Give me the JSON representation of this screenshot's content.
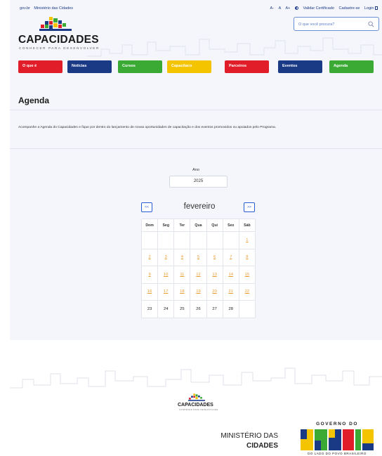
{
  "topbar": {
    "gov_link": "gov.br",
    "ministry_link": "Ministério das Cidades",
    "font_decrease": "A-",
    "font_normal": "A",
    "font_increase": "A+",
    "validate": "Validar Certificado",
    "register": "Cadastre-se",
    "login": "Login"
  },
  "logo": {
    "name": "CAPACIDADES",
    "tagline": "CONHECER PARA DESENVOLVER"
  },
  "search": {
    "placeholder": "O que você procura?"
  },
  "nav": {
    "items": [
      {
        "label": "O que é",
        "color": "#e11d2a"
      },
      {
        "label": "Notícias",
        "color": "#1b3a86"
      },
      {
        "label": "Cursos",
        "color": "#3aaa35"
      },
      {
        "label": "Capacitaco",
        "color": "#f5c400"
      },
      {
        "label": "Parceiros",
        "color": "#e11d2a"
      },
      {
        "label": "Eventos",
        "color": "#1b3a86"
      },
      {
        "label": "Agenda",
        "color": "#3aaa35"
      }
    ]
  },
  "page": {
    "title": "Agenda",
    "description": "Acompanhe a Agenda do Capacidades e fique por dentro do lançamento de novas oportunidades de capacitação e dos eventos promovidos ou apoiados pelo Programa."
  },
  "calendar": {
    "year_label": "Ano",
    "year": "2025",
    "prev": "<<",
    "next": ">>",
    "month": "fevereiro",
    "weekdays": [
      "Dom",
      "Seg",
      "Ter",
      "Qua",
      "Qui",
      "Sex",
      "Sáb"
    ],
    "weeks": [
      [
        "",
        "",
        "",
        "",
        "",
        "",
        "1"
      ],
      [
        "2",
        "3",
        "4",
        "5",
        "6",
        "7",
        "8"
      ],
      [
        "9",
        "10",
        "11",
        "12",
        "13",
        "14",
        "15"
      ],
      [
        "16",
        "17",
        "18",
        "19",
        "20",
        "21",
        "22"
      ],
      [
        "23",
        "24",
        "25",
        "26",
        "27",
        "28",
        ""
      ]
    ],
    "linked_days_through": 22,
    "link_color": "#e89a2e"
  },
  "footer": {
    "logo_name": "CAPACIDADES",
    "logo_tagline": "CONHECER PARA DESENVOLVER",
    "ministry_line1": "MINISTÉRIO DAS",
    "ministry_line2": "CIDADES",
    "gov_top": "GOVERNO DO",
    "gov_word": "BRASIL",
    "gov_bottom": "DO LADO DO POVO BRASILEIRO"
  }
}
